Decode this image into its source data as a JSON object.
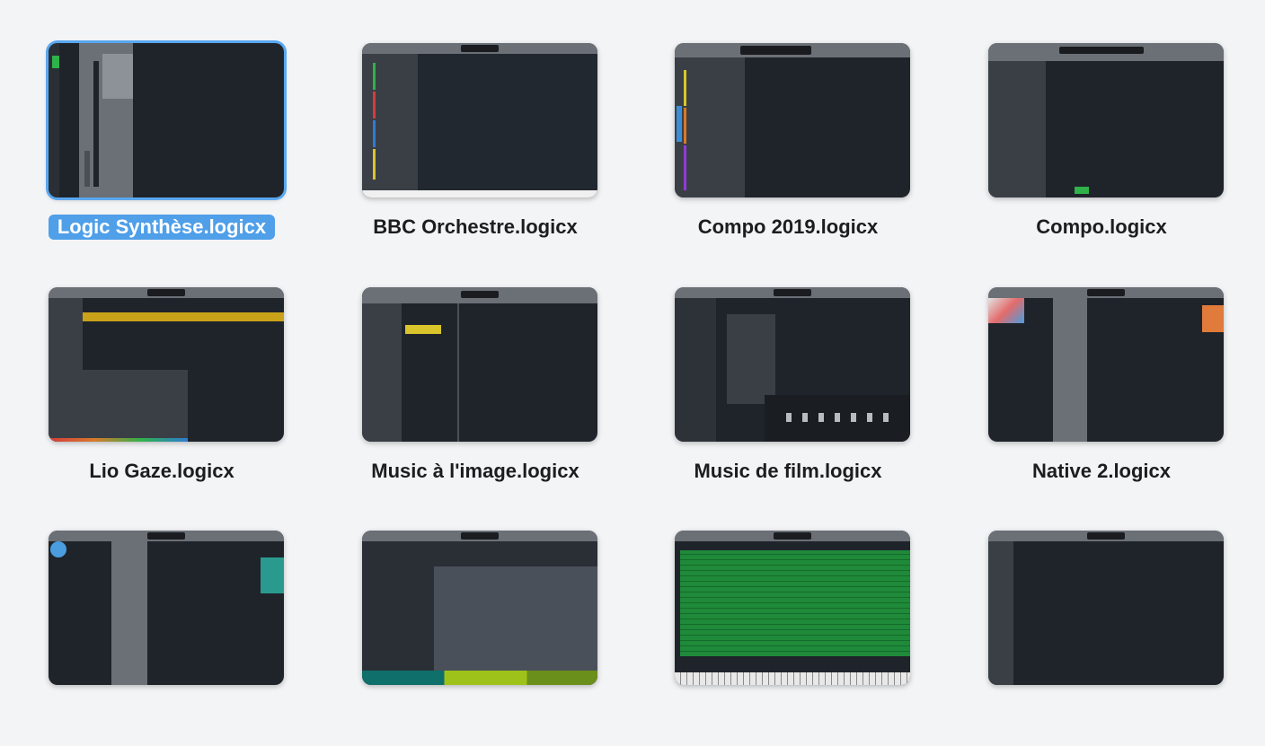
{
  "colors": {
    "background": "#f3f4f6",
    "selection": "#4f9fe9",
    "thumb_bg": "#1f242b",
    "panel": "#3a3f46",
    "toolbar": "#6b6f76"
  },
  "files": [
    {
      "name": "Logic Synthèse.logicx",
      "selected": true
    },
    {
      "name": "BBC Orchestre.logicx",
      "selected": false
    },
    {
      "name": "Compo 2019.logicx",
      "selected": false
    },
    {
      "name": "Compo.logicx",
      "selected": false
    },
    {
      "name": "Lio Gaze.logicx",
      "selected": false
    },
    {
      "name": "Music à l'image.logicx",
      "selected": false
    },
    {
      "name": "Music de film.logicx",
      "selected": false
    },
    {
      "name": "Native 2.logicx",
      "selected": false
    },
    {
      "name": "",
      "selected": false
    },
    {
      "name": "",
      "selected": false
    },
    {
      "name": "",
      "selected": false
    },
    {
      "name": "",
      "selected": false
    }
  ]
}
